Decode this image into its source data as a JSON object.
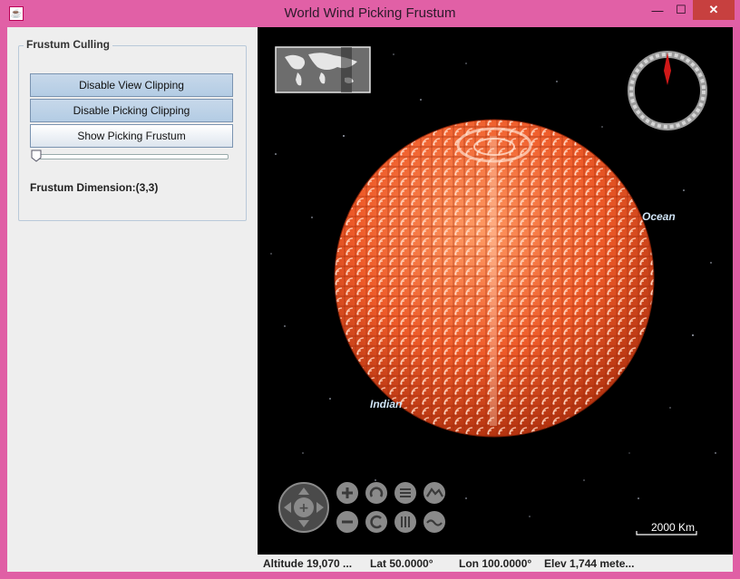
{
  "window": {
    "title": "World Wind Picking Frustum",
    "minimize": "—",
    "maximize": "☐",
    "close": "✕"
  },
  "panel": {
    "legend": "Frustum Culling",
    "buttons": [
      {
        "label": "Disable View Clipping",
        "selected": true
      },
      {
        "label": "Disable Picking Clipping",
        "selected": true
      },
      {
        "label": "Show Picking Frustum",
        "selected": false
      }
    ],
    "slider": {
      "value": 0
    },
    "dimension_label": "Frustum Dimension:(3,3)"
  },
  "map": {
    "labels": {
      "ocean": "Ocean",
      "indian": "Indian",
      "scale": "2000 Km"
    },
    "colors": {
      "sphere": "#ee5a28",
      "sphere_light": "#ffb08a",
      "background": "#000000",
      "compass_needle": "#d01818"
    },
    "icons": [
      "compass-icon",
      "pan-icon",
      "zoom-in-icon",
      "zoom-out-icon",
      "rotate-left-icon",
      "rotate-right-icon",
      "tilt-up-icon",
      "tilt-down-icon",
      "exaggeration-up-icon",
      "exaggeration-down-icon"
    ]
  },
  "status": {
    "altitude": "Altitude  19,070 ...",
    "lat": "Lat  50.0000°",
    "lon": "Lon  100.0000°",
    "elev": "Elev  1,744 mete..."
  }
}
